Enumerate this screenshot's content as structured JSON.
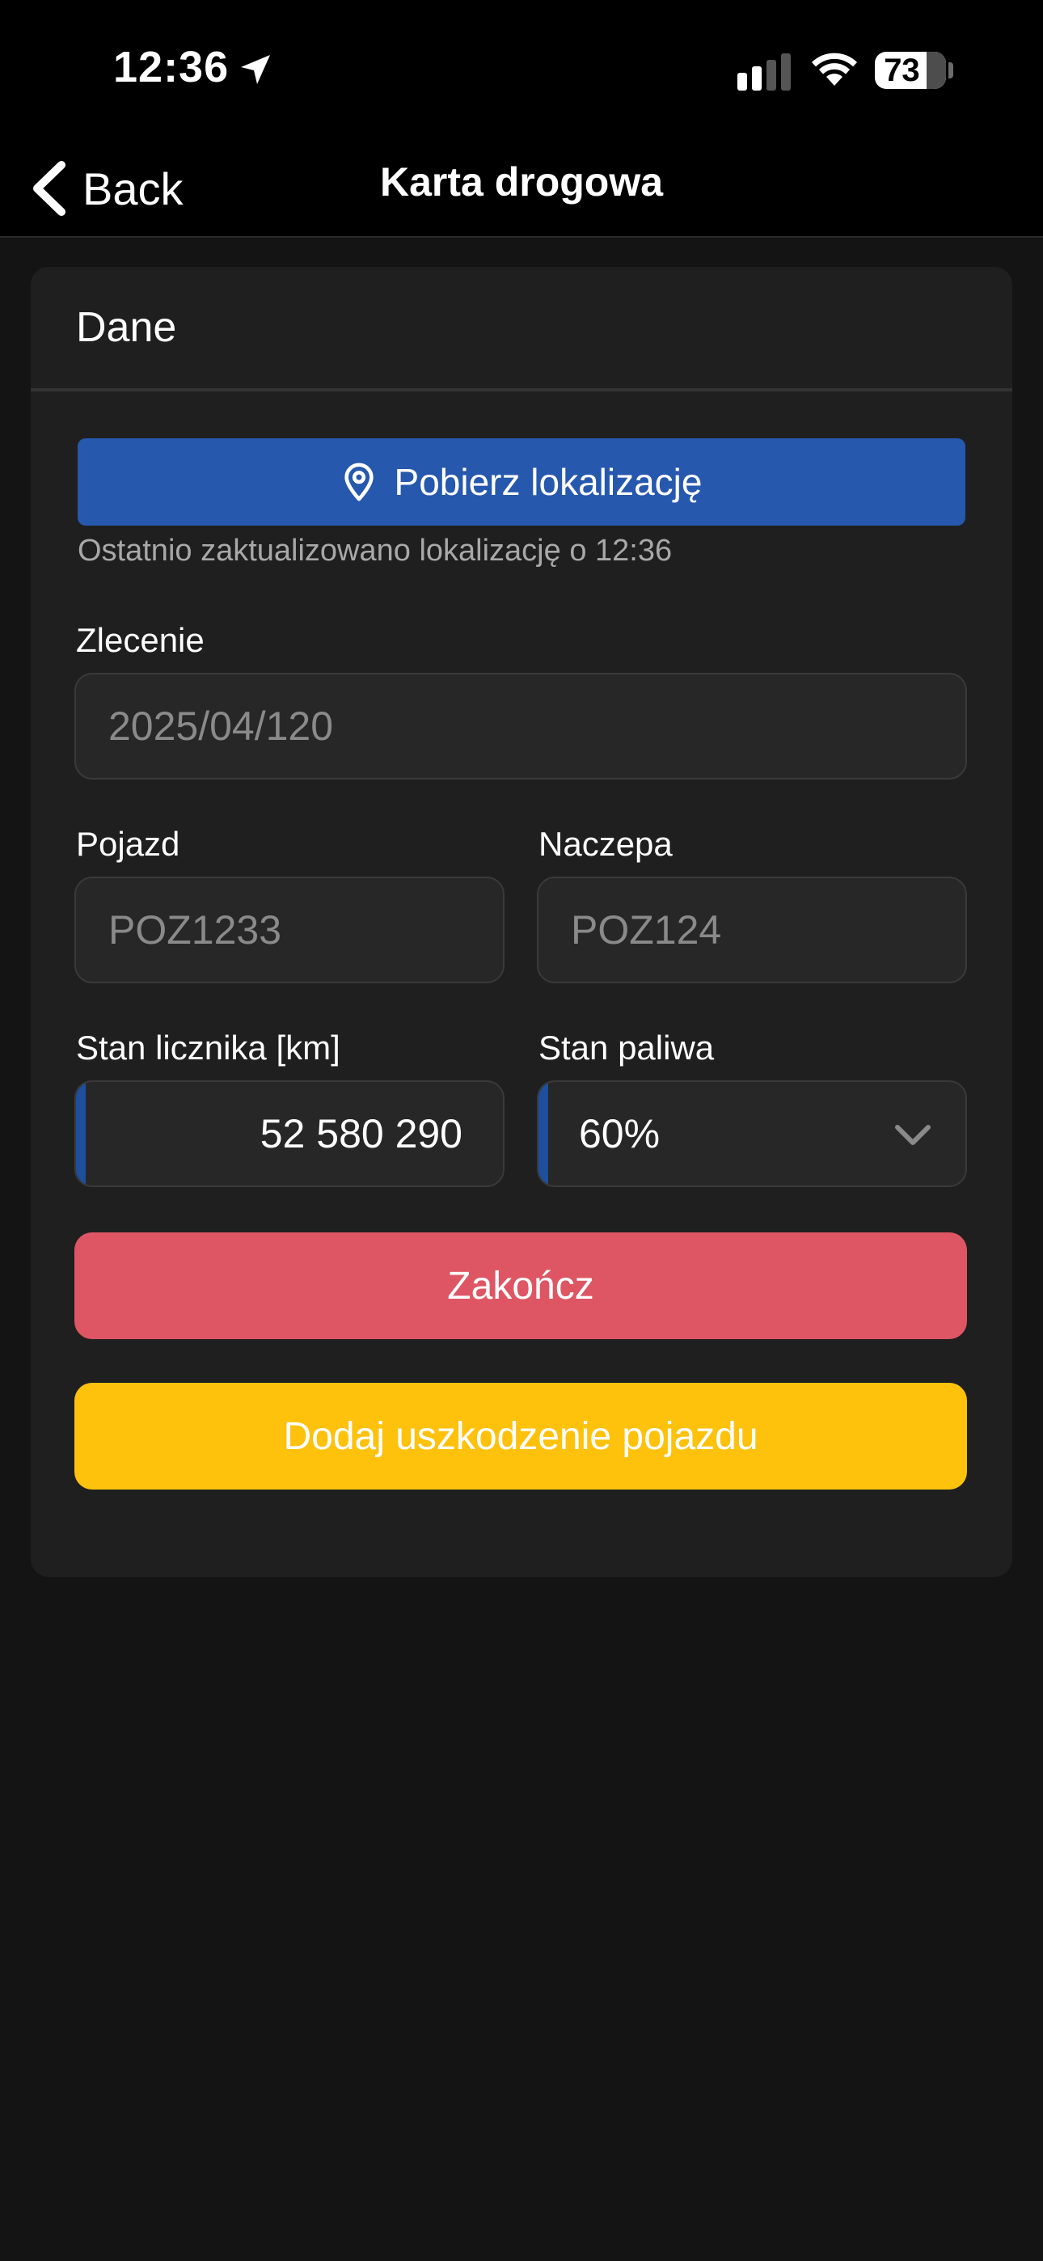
{
  "status_bar": {
    "time": "12:36",
    "battery": "73",
    "battery_level_percent": 73
  },
  "nav": {
    "back_label": "Back",
    "title": "Karta drogowa"
  },
  "card": {
    "title": "Dane",
    "location_button_label": "Pobierz lokalizację",
    "location_status": "Ostatnio zaktualizowano lokalizację o 12:36",
    "order": {
      "label": "Zlecenie",
      "value": "2025/04/120"
    },
    "vehicle": {
      "label": "Pojazd",
      "value": "POZ1233"
    },
    "trailer": {
      "label": "Naczepa",
      "value": "POZ124"
    },
    "odometer": {
      "label": "Stan licznika [km]",
      "value": "52 580 290"
    },
    "fuel": {
      "label": "Stan paliwa",
      "value": "60%"
    },
    "finish_button_label": "Zakończ",
    "damage_button_label": "Dodaj uszkodzenie pojazdu"
  },
  "colors": {
    "location_button": "#2658ad",
    "finish_button": "#de5664",
    "damage_button": "#fec20d",
    "background": "#141414",
    "card": "#1f1f1f"
  },
  "icons": {
    "status_location": "location-arrow-icon",
    "signal": "cellular-signal-icon",
    "wifi": "wifi-icon",
    "back": "chevron-left-icon",
    "pin": "map-pin-icon",
    "dropdown": "chevron-down-icon"
  }
}
